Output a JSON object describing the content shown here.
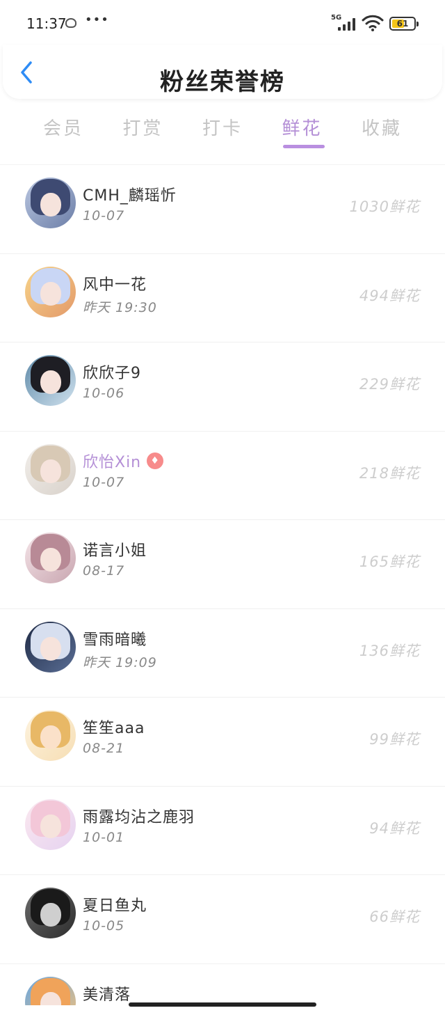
{
  "status_bar": {
    "time": "11:37",
    "dots": "•••",
    "network": "5G",
    "battery": "61"
  },
  "header": {
    "title": "粉丝荣誉榜",
    "back_icon": "chevron-left-icon",
    "accent_color": "#2e8cf5"
  },
  "tabs": [
    {
      "label": "会员",
      "active": false
    },
    {
      "label": "打赏",
      "active": false
    },
    {
      "label": "打卡",
      "active": false
    },
    {
      "label": "鲜花",
      "active": true
    },
    {
      "label": "收藏",
      "active": false
    }
  ],
  "colors": {
    "active_tab": "#b48fd6",
    "vip_name": "#b48fd6",
    "vip_badge": "#f78b8b"
  },
  "fans": [
    {
      "name": "CMH_麟瑶忻",
      "date": "10-07",
      "amount": "1030鲜花",
      "vip": false
    },
    {
      "name": "风中一花",
      "date": "昨天 19:30",
      "amount": "494鲜花",
      "vip": false
    },
    {
      "name": "欣欣子9",
      "date": "10-06",
      "amount": "229鲜花",
      "vip": false
    },
    {
      "name": "欣怡Xin",
      "date": "10-07",
      "amount": "218鲜花",
      "vip": true
    },
    {
      "name": "诺言小姐",
      "date": "08-17",
      "amount": "165鲜花",
      "vip": false
    },
    {
      "name": "雪雨暗曦",
      "date": "昨天 19:09",
      "amount": "136鲜花",
      "vip": false
    },
    {
      "name": "笙笙aaa",
      "date": "08-21",
      "amount": "99鲜花",
      "vip": false
    },
    {
      "name": "雨露均沾之鹿羽",
      "date": "10-01",
      "amount": "94鲜花",
      "vip": false
    },
    {
      "name": "夏日鱼丸",
      "date": "10-05",
      "amount": "66鲜花",
      "vip": false
    },
    {
      "name": "美清落",
      "date": "",
      "amount": "",
      "vip": false
    }
  ]
}
